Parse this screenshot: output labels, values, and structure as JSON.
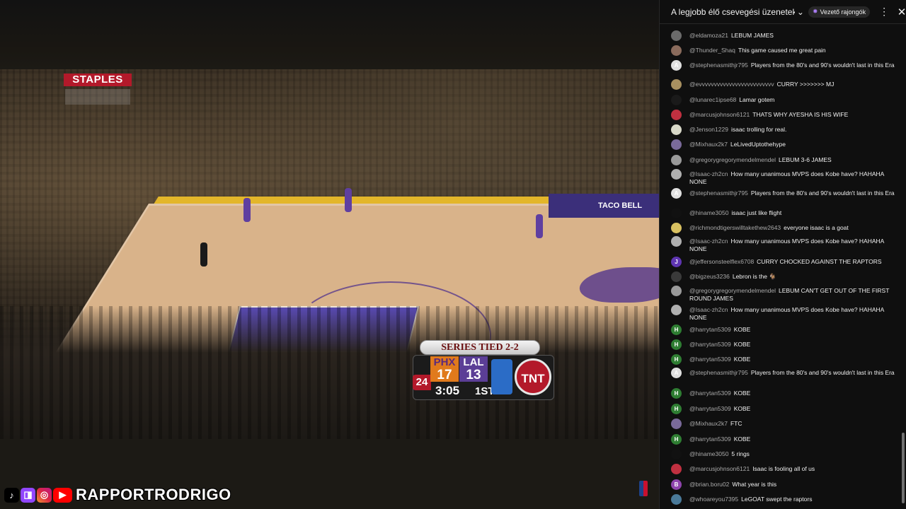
{
  "video": {
    "arena_sign": "STAPLES",
    "ad_board": "TACO BELL",
    "scoreboard": {
      "series": "SERIES TIED 2-2",
      "shot_clock": "24",
      "team1": {
        "abbr": "PHX",
        "score": "17"
      },
      "team2": {
        "abbr": "LAL",
        "score": "13"
      },
      "clock": "3:05",
      "period": "1ST",
      "network": "TNT"
    },
    "brand_name": "RAPPORTRODRIGO",
    "socials": [
      "tiktok-icon",
      "twitch-icon",
      "instagram-icon",
      "youtube-icon"
    ]
  },
  "chat": {
    "title": "A legjobb élő csevegési üzenetek újra",
    "fans_button": "Vezető rajongók",
    "messages": [
      {
        "author": "@eldamoza21",
        "text": "LEBUM JAMES",
        "avatar": "",
        "color": "#6b6b6b"
      },
      {
        "author": "@Thunder_Shaq",
        "text": "This game caused me great pain",
        "avatar": "",
        "color": "#8a6b5c"
      },
      {
        "author": "@stephenasmithjr795",
        "text": "Players from the 80's and 90's wouldn't last in this Era",
        "avatar": "A",
        "color": "#e0e0e0"
      },
      {
        "author": "@evvvvvvvvvvvvvvvvvvvvvvvvv",
        "text": "CURRY >>>>>>> MJ",
        "avatar": "",
        "color": "#a89060"
      },
      {
        "author": "@lunarec1ipse68",
        "text": "Lamar gotem",
        "avatar": "",
        "color": "#1a1a1a"
      },
      {
        "author": "@marcusjohnson6121",
        "text": "THATS WHY AYESHA IS HIS WIFE",
        "avatar": "",
        "color": "#c03040"
      },
      {
        "author": "@Jenson1229",
        "text": "isaac trolling for real.",
        "avatar": "",
        "color": "#d8d8c8"
      },
      {
        "author": "@Mixhaux2k7",
        "text": "LeLivedUptothehype",
        "avatar": "",
        "color": "#7a6a9a"
      },
      {
        "author": "@gregorygregorymendelmendel",
        "text": "LEBUM 3-6 JAMES",
        "avatar": "",
        "color": "#9a9a9a"
      },
      {
        "author": "@Isaac-zh2cn",
        "text": "How many unanimous MVPS does Kobe have? HAHAHA NONE",
        "avatar": "",
        "color": "#b0b0b0"
      },
      {
        "author": "@stephenasmithjr795",
        "text": "Players from the 80's and 90's wouldn't last in this Era",
        "avatar": "A",
        "color": "#e0e0e0"
      },
      {
        "author": "@hiname3050",
        "text": "isaac just like flight",
        "avatar": "",
        "color": "#111111"
      },
      {
        "author": "@richmondtigerswilltakethew2643",
        "text": "everyone isaac is a goat",
        "avatar": "",
        "color": "#d8c060"
      },
      {
        "author": "@Isaac-zh2cn",
        "text": "How many unanimous MVPS does Kobe have? HAHAHA NONE",
        "avatar": "",
        "color": "#b0b0b0"
      },
      {
        "author": "@jeffersonsteelflex6708",
        "text": "CURRY CHOCKED AGAINST THE RAPTORS",
        "avatar": "J",
        "color": "#5e35b1"
      },
      {
        "author": "@bigzeus3236",
        "text": "Lebron is the 🐐",
        "avatar": "",
        "color": "#3a3a3a"
      },
      {
        "author": "@gregorygregorymendelmendel",
        "text": "LEBUM CAN'T GET OUT OF THE FIRST ROUND JAMES",
        "avatar": "",
        "color": "#9a9a9a"
      },
      {
        "author": "@Isaac-zh2cn",
        "text": "How many unanimous MVPS does Kobe have? HAHAHA NONE",
        "avatar": "",
        "color": "#b0b0b0"
      },
      {
        "author": "@harrytan5309",
        "text": "KOBE",
        "avatar": "H",
        "color": "#2e7d32"
      },
      {
        "author": "@harrytan5309",
        "text": "KOBE",
        "avatar": "H",
        "color": "#2e7d32"
      },
      {
        "author": "@harrytan5309",
        "text": "KOBE",
        "avatar": "H",
        "color": "#2e7d32"
      },
      {
        "author": "@stephenasmithjr795",
        "text": "Players from the 80's and 90's wouldn't last in this Era",
        "avatar": "A",
        "color": "#e0e0e0"
      },
      {
        "author": "@harrytan5309",
        "text": "KOBE",
        "avatar": "H",
        "color": "#2e7d32"
      },
      {
        "author": "@harrytan5309",
        "text": "KOBE",
        "avatar": "H",
        "color": "#2e7d32"
      },
      {
        "author": "@Mixhaux2k7",
        "text": "FTC",
        "avatar": "",
        "color": "#7a6a9a"
      },
      {
        "author": "@harrytan5309",
        "text": "KOBE",
        "avatar": "H",
        "color": "#2e7d32"
      },
      {
        "author": "@hiname3050",
        "text": "5 rings",
        "avatar": "",
        "color": "#111111"
      },
      {
        "author": "@marcusjohnson6121",
        "text": "Isaac is fooling all of us",
        "avatar": "",
        "color": "#c03040"
      },
      {
        "author": "@brian.boru02",
        "text": "What year is this",
        "avatar": "B",
        "color": "#8e44ad"
      },
      {
        "author": "@whoareyou7395",
        "text": "LeGOAT swept the raptors",
        "avatar": "",
        "color": "#4a7a9a"
      }
    ]
  }
}
